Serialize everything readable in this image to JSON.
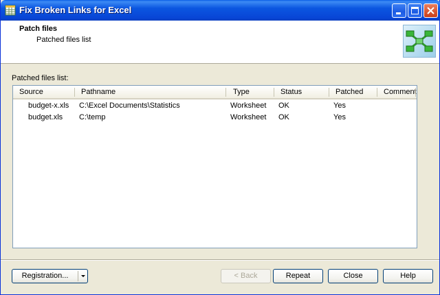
{
  "window": {
    "title": "Fix Broken Links for Excel"
  },
  "header": {
    "title": "Patch files",
    "subtitle": "Patched files list"
  },
  "list": {
    "label": "Patched files list:",
    "columns": [
      "Source",
      "Pathname",
      "Type",
      "Status",
      "Patched",
      "Comment"
    ],
    "rows": [
      {
        "source": "budget-x.xls",
        "pathname": "C:\\Excel Documents\\Statistics",
        "type": "Worksheet",
        "status": "OK",
        "patched": "Yes",
        "comment": ""
      },
      {
        "source": "budget.xls",
        "pathname": "C:\\temp",
        "type": "Worksheet",
        "status": "OK",
        "patched": "Yes",
        "comment": ""
      }
    ]
  },
  "buttons": {
    "registration": "Registration...",
    "back": "< Back",
    "repeat": "Repeat",
    "close": "Close",
    "help": "Help"
  }
}
